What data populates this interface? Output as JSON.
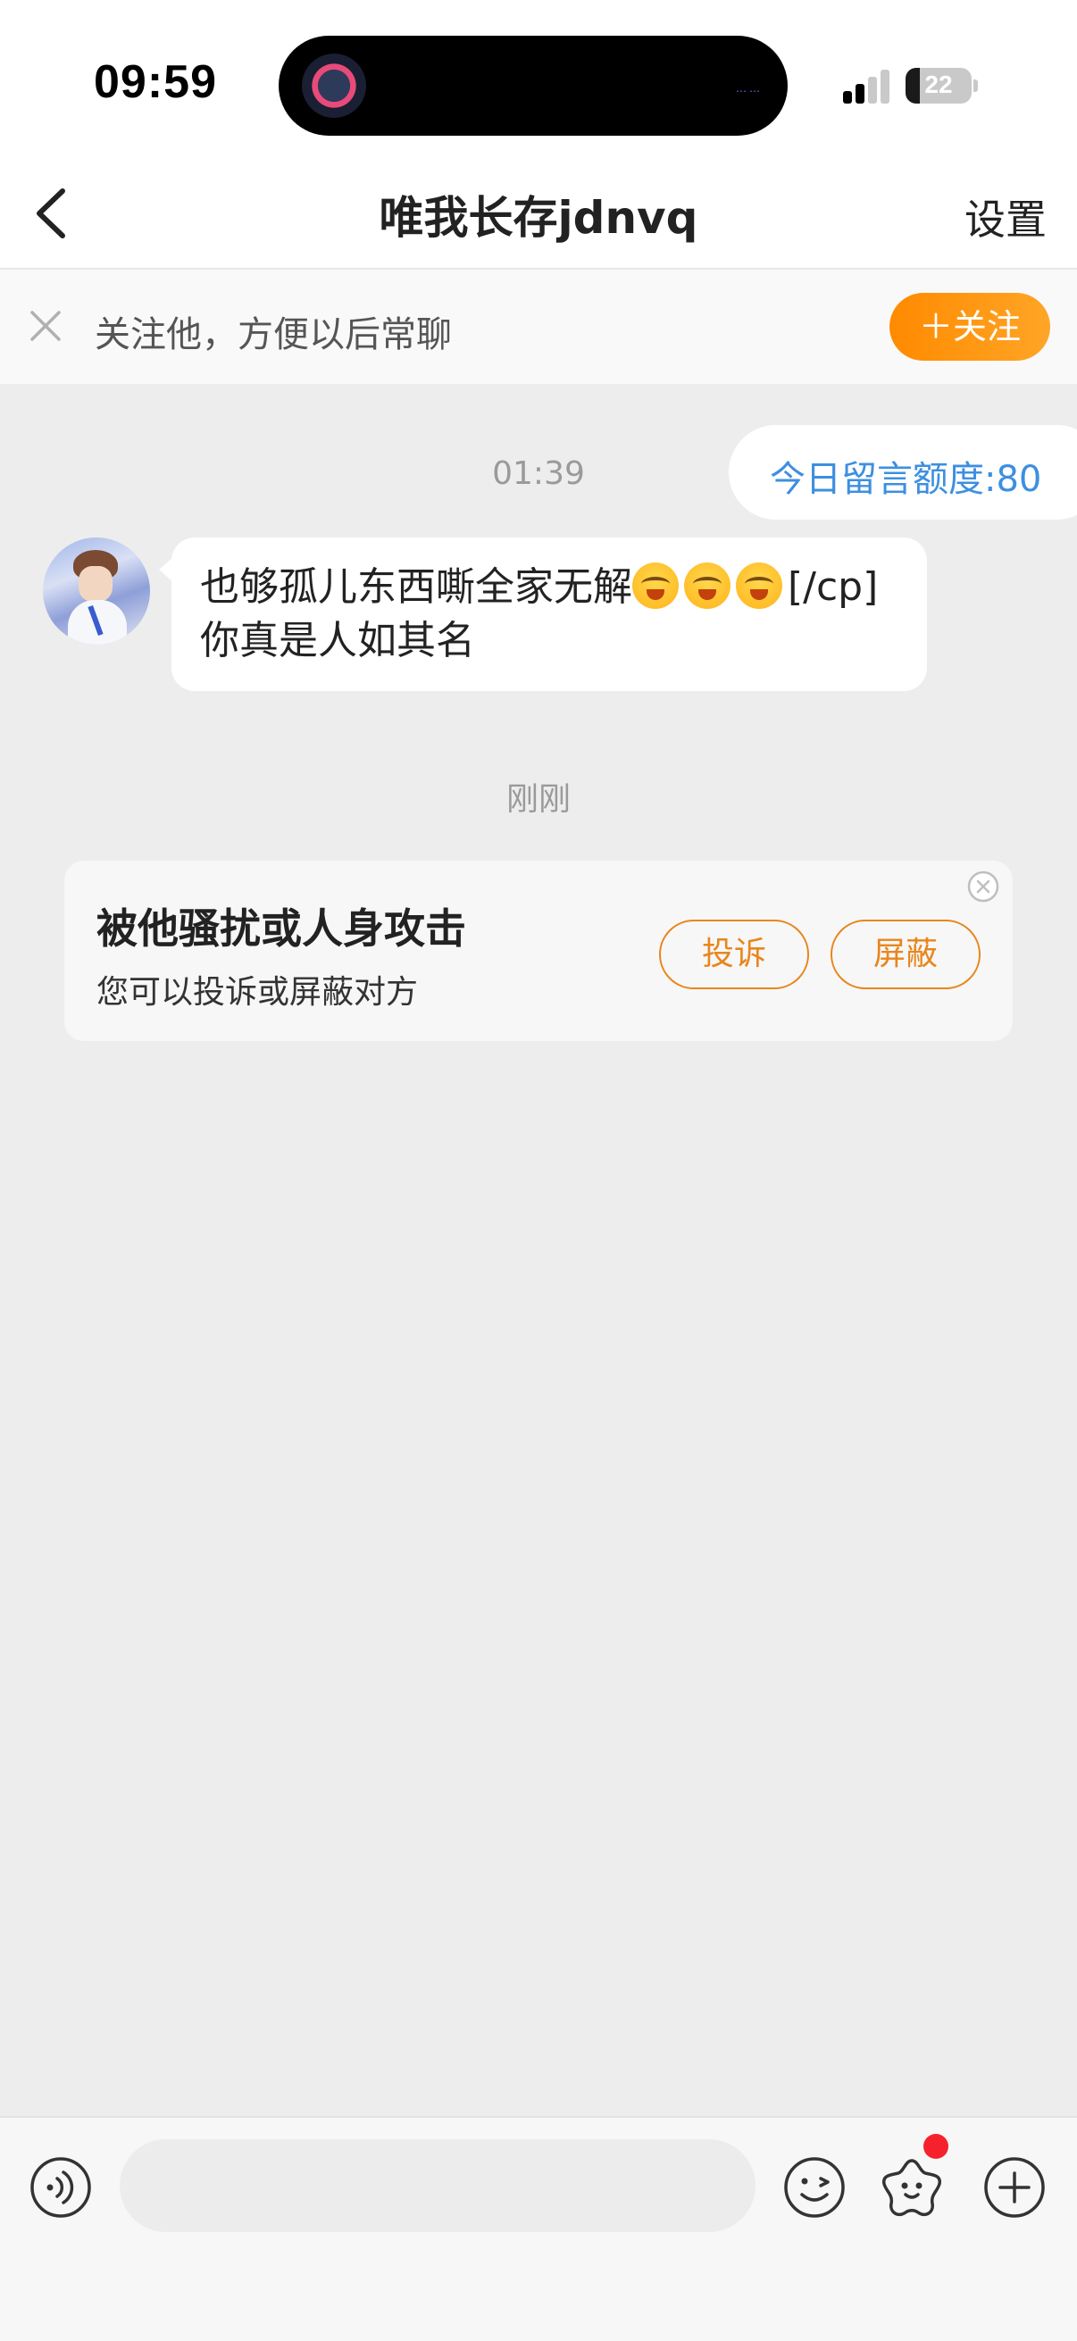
{
  "status_bar": {
    "time": "09:59",
    "battery": "22",
    "battery_level": 0.22,
    "island_dots": "……"
  },
  "header": {
    "title": "唯我长存jdnvq",
    "settings_label": "设置"
  },
  "follow_banner": {
    "text": "关注他，方便以后常聊",
    "follow_label": "＋关注",
    "accent": "#ff8a00"
  },
  "chat": {
    "quota_label": "今日留言额度:80",
    "timestamp_1": "01:39",
    "message_text_a": "也够孤儿东西嘶全家无解",
    "message_text_b": "[/cp] 你真是人如其名",
    "timestamp_2": "刚刚"
  },
  "harassment_card": {
    "title": "被他骚扰或人身攻击",
    "subtitle": "您可以投诉或屏蔽对方",
    "complain_label": "投诉",
    "block_label": "屏蔽",
    "accent": "#e8861c"
  },
  "input_bar": {
    "placeholder": "",
    "icons": [
      "voice-icon",
      "emoji-icon",
      "sticker-icon",
      "plus-icon"
    ]
  }
}
